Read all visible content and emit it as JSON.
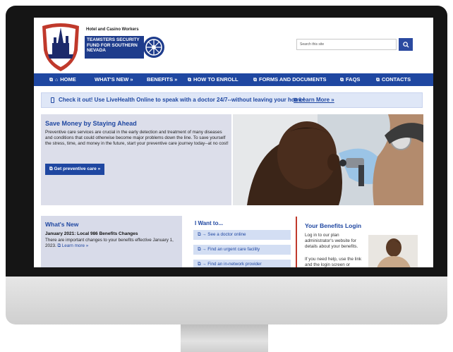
{
  "logo": {
    "top_text": "Hotel and Casino Workers",
    "line1": "TEAMSTERS SECURITY",
    "line2": "FUND FOR SOUTHERN",
    "line3": "NEVADA"
  },
  "search": {
    "placeholder": "Search this site"
  },
  "nav": [
    {
      "label": "HOME",
      "icon": "home-icon"
    },
    {
      "label": "WHAT'S NEW »"
    },
    {
      "label": "BENEFITS »"
    },
    {
      "label": "HOW TO ENROLL"
    },
    {
      "label": "FORMS AND DOCUMENTS"
    },
    {
      "label": "FAQS"
    },
    {
      "label": "CONTACTS"
    }
  ],
  "banner": {
    "text": "Check it out! Use LiveHealth Online to speak with a doctor 24/7--without leaving your home!",
    "link": "Learn More »"
  },
  "hero": {
    "title": "Save Money by Staying Ahead",
    "body": "Preventive care services are crucial in the early detection and treatment of many diseases and conditions that could otherwise become major problems down the line. To save yourself the stress, time, and money in the future, start your preventive care journey today--at no cost!",
    "button": "Get preventive care »"
  },
  "whats_new": {
    "title": "What's New",
    "subtitle": "January 2021: Local 986 Benefits Changes",
    "body": "There are important changes to your benefits effective January 1, 2023.",
    "link": "Learn more »"
  },
  "i_want": {
    "title": "I Want to...",
    "items": [
      "→ See a doctor online",
      "→ Find an urgent care facility",
      "→ Find an in-network provider"
    ]
  },
  "benefits_login": {
    "title": "Your Benefits Login",
    "body": "Log in to our plan administrator's website for details about your benefits.",
    "body2": "If you need help, use the link and the login screen or"
  },
  "colors": {
    "nav_blue": "#1f47a1",
    "banner_bg": "#dfe7f7",
    "accent_red": "#c0392b"
  }
}
